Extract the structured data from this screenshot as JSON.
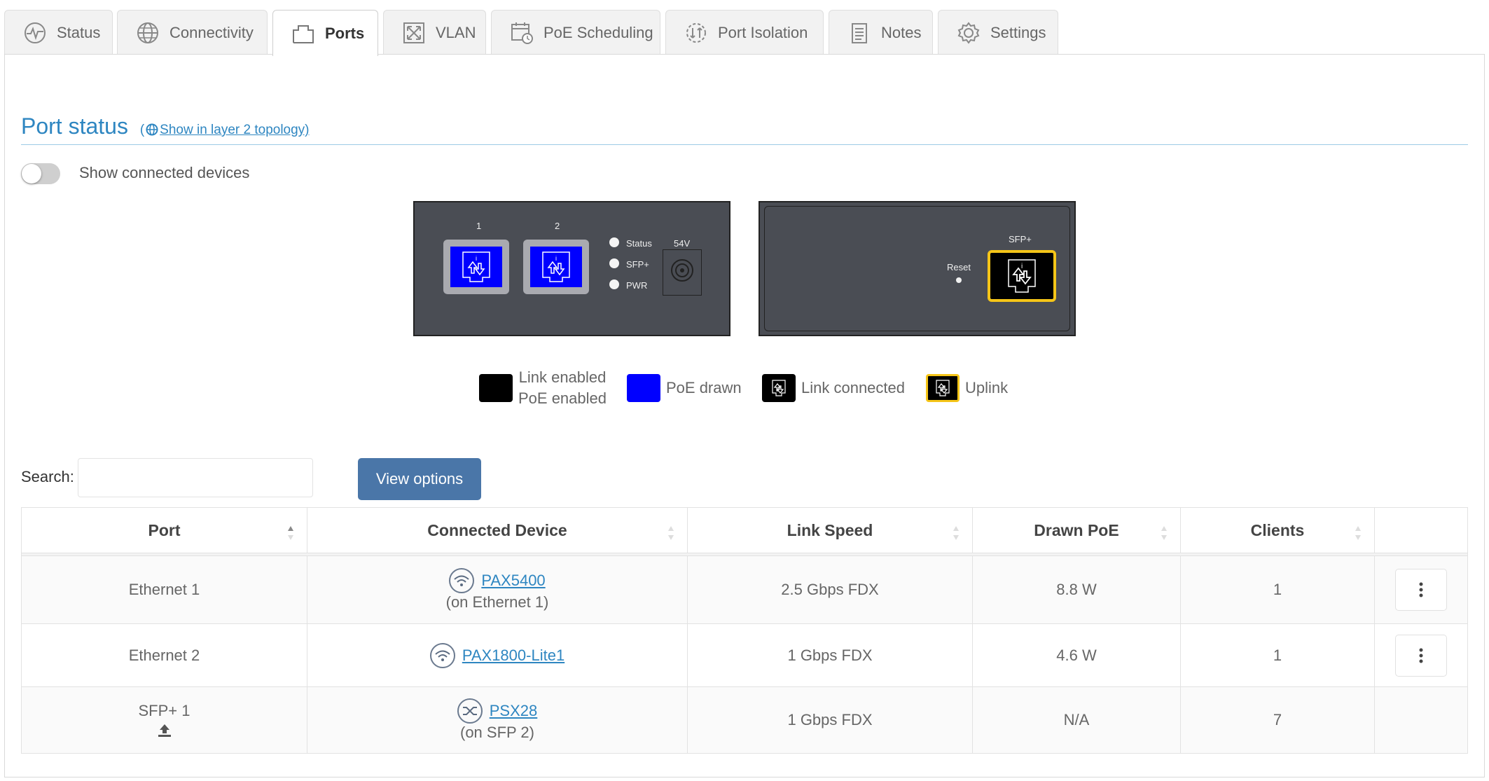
{
  "tabs": [
    {
      "label": "Status",
      "icon": "activity-icon"
    },
    {
      "label": "Connectivity",
      "icon": "globe-icon"
    },
    {
      "label": "Ports",
      "icon": "port-icon",
      "active": true
    },
    {
      "label": "VLAN",
      "icon": "vlan-icon"
    },
    {
      "label": "PoE Scheduling",
      "icon": "calendar-clock-icon"
    },
    {
      "label": "Port Isolation",
      "icon": "isolation-icon"
    },
    {
      "label": "Notes",
      "icon": "notepad-icon"
    },
    {
      "label": "Settings",
      "icon": "gear-icon"
    }
  ],
  "port_status": {
    "title": "Port status",
    "topology_link": "Show in layer 2 topology)",
    "topology_paren": "(",
    "toggle_label": "Show connected devices",
    "toggle_on": false
  },
  "front_panel": {
    "port_labels": [
      "1",
      "2"
    ],
    "leds": [
      "Status",
      "SFP+",
      "PWR"
    ],
    "power_label": "54V"
  },
  "rear_panel": {
    "reset_label": "Reset",
    "sfp_label": "SFP+"
  },
  "legend": {
    "link_enabled": "Link enabled",
    "poe_enabled": "PoE enabled",
    "poe_drawn": "PoE drawn",
    "link_connected": "Link connected",
    "uplink": "Uplink"
  },
  "colors": {
    "accent": "#2e86c1",
    "poe_blue": "#0000ff",
    "uplink_yellow": "#f5c518",
    "button": "#4a76a8"
  },
  "search": {
    "label": "Search:",
    "value": "",
    "placeholder": ""
  },
  "view_options_label": "View options",
  "table": {
    "headers": [
      "Port",
      "Connected Device",
      "Link Speed",
      "Drawn PoE",
      "Clients"
    ],
    "rows": [
      {
        "port": "Ethernet 1",
        "device": "PAX5400",
        "device_icon": "wifi-icon",
        "device_sub": "(on Ethernet 1)",
        "speed": "2.5 Gbps FDX",
        "poe": "8.8 W",
        "clients": "1"
      },
      {
        "port": "Ethernet 2",
        "device": "PAX1800-Lite1",
        "device_icon": "wifi-icon",
        "device_sub": "",
        "speed": "1 Gbps FDX",
        "poe": "4.6 W",
        "clients": "1"
      },
      {
        "port": "SFP+ 1",
        "device": "PSX28",
        "device_icon": "switch-icon",
        "device_sub": "(on SFP 2)",
        "speed": "1 Gbps FDX",
        "poe": "N/A",
        "clients": "7"
      }
    ]
  }
}
